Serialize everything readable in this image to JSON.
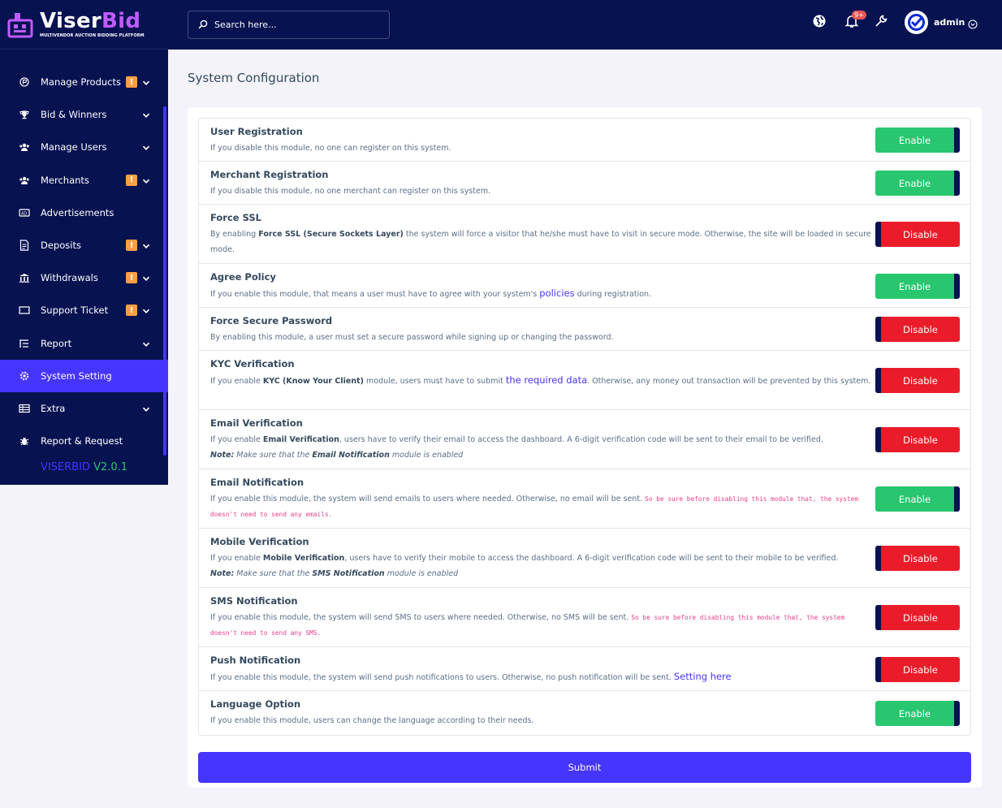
{
  "brand": {
    "name_part1": "Viser",
    "name_part2": "Bid",
    "tagline": "MULTIVENDOR AUCTION BIDDING PLATFORM",
    "accent": "#4634ff"
  },
  "search": {
    "placeholder": "Search here..."
  },
  "topbar": {
    "notif_count": "9+",
    "admin_name": "admin"
  },
  "sidebar": {
    "items": [
      {
        "label": "Manage Products",
        "icon": "product-icon",
        "badge": "!",
        "has_chevron": true
      },
      {
        "label": "Bid & Winners",
        "icon": "trophy-icon",
        "has_chevron": true
      },
      {
        "label": "Manage Users",
        "icon": "users-icon",
        "has_chevron": true
      },
      {
        "label": "Merchants",
        "icon": "merchants-icon",
        "badge": "!",
        "has_chevron": true
      },
      {
        "label": "Advertisements",
        "icon": "ad-icon"
      },
      {
        "label": "Deposits",
        "icon": "deposit-icon",
        "badge": "!",
        "has_chevron": true
      },
      {
        "label": "Withdrawals",
        "icon": "bank-icon",
        "badge": "!",
        "has_chevron": true
      },
      {
        "label": "Support Ticket",
        "icon": "ticket-icon",
        "badge": "!",
        "has_chevron": true
      },
      {
        "label": "Report",
        "icon": "list-icon",
        "has_chevron": true
      },
      {
        "label": "System Setting",
        "icon": "gear-icon",
        "active": true
      },
      {
        "label": "Extra",
        "icon": "server-icon",
        "has_chevron": true
      },
      {
        "label": "Report & Request",
        "icon": "bug-icon"
      }
    ],
    "version_name": "VISERBID",
    "version_number": "V2.0.1"
  },
  "page": {
    "title": "System Configuration",
    "submit_label": "Submit"
  },
  "modules": [
    {
      "title": "User Registration",
      "desc_html": "If you disable this module, no one can register on this system.",
      "status": "Enable"
    },
    {
      "title": "Merchant Registration",
      "desc_html": "If you disable this module, no one merchant can register on this system.",
      "status": "Enable"
    },
    {
      "title": "Force SSL",
      "desc_html": "By enabling <b>Force SSL (Secure Sockets Layer)</b> the system will force a visitor that he/she must have to visit in secure mode. Otherwise, the site will be loaded in secure mode.",
      "status": "Disable"
    },
    {
      "title": "Agree Policy",
      "desc_html": "If you enable this module, that means a user must have to agree with your system's <a>policies</a> during registration.",
      "status": "Enable"
    },
    {
      "title": "Force Secure Password",
      "desc_html": "By enabling this module, a user must set a secure password while signing up or changing the password.",
      "status": "Disable"
    },
    {
      "title": "KYC Verification",
      "desc_html": "If you enable <b>KYC (Know Your Client)</b> module, users must have to submit <a>the required data</a>. Otherwise, any money out transaction will be prevented by this system.",
      "status": "Disable"
    },
    {
      "title": "Email Verification",
      "desc_html": "If you enable <b>Email Verification</b>, users have to verify their email to access the dashboard. A 6-digit verification code will be sent to their email to be verified.<br><span class=\"note\"><b>Note:</b> Make sure that the <b>Email Notification</b> module is enabled</span>",
      "status": "Disable"
    },
    {
      "title": "Email Notification",
      "desc_html": "If you enable this module, the system will send emails to users where needed. Otherwise, no email will be sent. <code>So be sure before disabling this module that, the system doesn't need to send any emails.</code>",
      "status": "Enable"
    },
    {
      "title": "Mobile Verification",
      "desc_html": "If you enable <b>Mobile Verification</b>, users have to verify their mobile to access the dashboard. A 6-digit verification code will be sent to their mobile to be verified.<br><span class=\"note\"><b>Note:</b> Make sure that the <b>SMS Notification</b> module is enabled</span>",
      "status": "Disable"
    },
    {
      "title": "SMS Notification",
      "desc_html": "If you enable this module, the system will send SMS to users where needed. Otherwise, no SMS will be sent. <code>So be sure before disabling this module that, the system doesn't need to send any SMS.</code>",
      "status": "Disable"
    },
    {
      "title": "Push Notification",
      "desc_html": "If you enable this module, the system will send push notifications to users. Otherwise, no push notification will be sent. <a>Setting here</a>",
      "status": "Disable"
    },
    {
      "title": "Language Option",
      "desc_html": "If you enable this module, users can change the language according to their needs.",
      "status": "Enable"
    }
  ]
}
